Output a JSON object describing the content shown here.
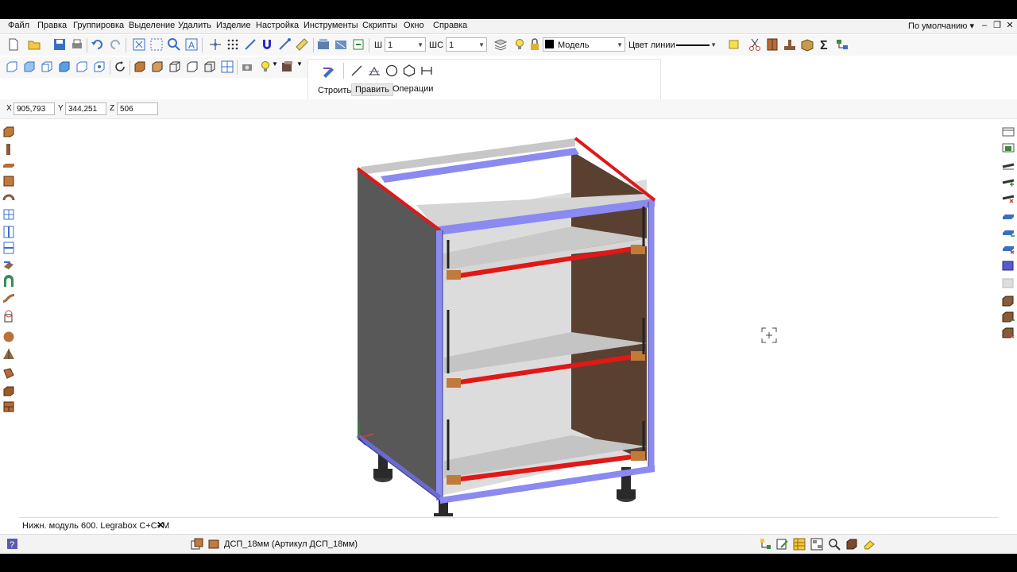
{
  "menu": [
    "Файл",
    "Правка",
    "Группировка",
    "Выделение",
    "Удалить",
    "Изделие",
    "Настройка",
    "Инструменты",
    "Скрипты",
    "Окно",
    "Справка"
  ],
  "profile": "По умолчанию",
  "toolbar": {
    "ш_label": "Ш",
    "ш_value": "1",
    "шс_label": "ШС",
    "шс_value": "1",
    "layer_value": "Модель",
    "line_color_label": "Цвет линии"
  },
  "panel": {
    "tabs": [
      "Строить",
      "Править",
      "Операции"
    ],
    "active_tab": "Править"
  },
  "coords": {
    "x_label": "X",
    "x": "905,793",
    "y_label": "Y",
    "y": "344,251",
    "z_label": "Z",
    "z": "506"
  },
  "document": {
    "tab_label": "Нижн. модуль 600. Legrabox C+C+M"
  },
  "status": {
    "material": "ДСП_18мм (Артикул ДСП_18мм)"
  },
  "colors": {
    "edge_red": "#e01818",
    "edge_blue": "#8a8af0",
    "panel_dark": "#5a5a5a",
    "shelf_gray": "#c9c9c9",
    "back_brown": "#5a4030"
  }
}
